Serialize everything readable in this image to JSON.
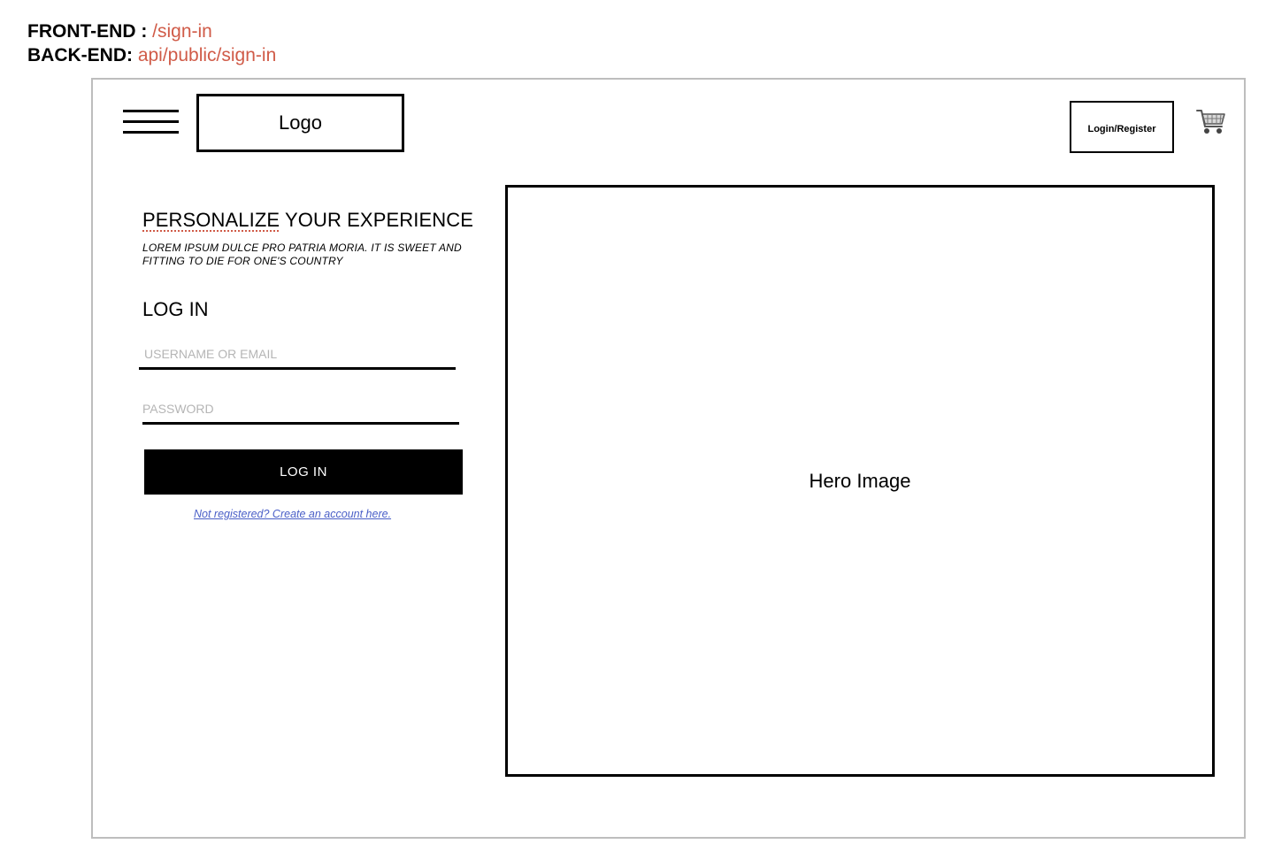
{
  "routes": {
    "frontend_label": "FRONT-END : ",
    "frontend_value": "/sign-in",
    "backend_label": "BACK-END: ",
    "backend_value": "api/public/sign-in"
  },
  "header": {
    "menu_icon": "hamburger-menu-icon",
    "logo_text": "Logo",
    "login_register_label": "Login/Register",
    "cart_icon": "shopping-cart-icon"
  },
  "intro": {
    "headline_part1": "PERSONALIZE",
    "headline_part2": " YOUR EXPERIENCE",
    "subtext": "LOREM IPSUM  DULCE PRO PATRIA MORIA. IT IS SWEET AND FITTING TO DIE FOR ONE'S COUNTRY"
  },
  "login_form": {
    "title": "LOG IN",
    "username_placeholder": "USERNAME OR EMAIL",
    "password_placeholder": "PASSWORD",
    "submit_label": "LOG IN",
    "register_link": "Not registered? Create an account here."
  },
  "hero": {
    "label": "Hero Image"
  },
  "colors": {
    "route_accent": "#d05b48",
    "link": "#4a5fc7",
    "frame_border": "#bdbdbd"
  }
}
